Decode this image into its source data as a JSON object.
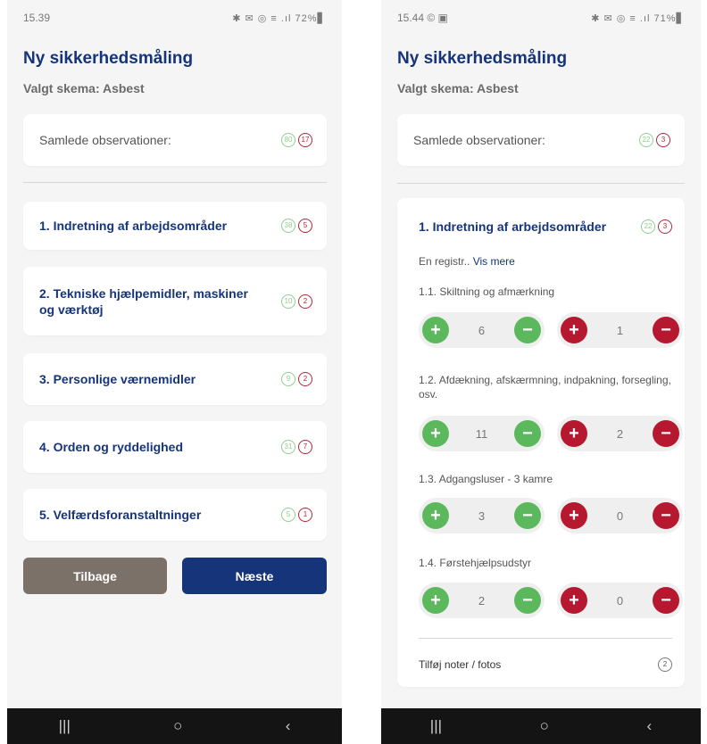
{
  "left": {
    "status_time": "15.39",
    "status_icons": "✱ ✉ ◎ ≡ .ıl 72%▋",
    "title": "Ny sikkerhedsmåling",
    "subtitle": "Valgt skema: Asbest",
    "totals": {
      "label": "Samlede observationer:",
      "green": "80",
      "red": "17"
    },
    "sections": [
      {
        "label": "1. Indretning af arbejdsområder",
        "green": "38",
        "red": "5"
      },
      {
        "label": "2. Tekniske hjælpemidler, maskiner og værktøj",
        "green": "10",
        "red": "2"
      },
      {
        "label": "3. Personlige værnemidler",
        "green": "9",
        "red": "2"
      },
      {
        "label": "4. Orden og ryddelighed",
        "green": "31",
        "red": "7"
      },
      {
        "label": "5. Velfærdsforanstaltninger",
        "green": "5",
        "red": "1"
      }
    ],
    "back_label": "Tilbage",
    "next_label": "Næste"
  },
  "right": {
    "status_time": "15.44 © ▣",
    "status_icons": "✱ ✉ ◎ ≡ .ıl 71%▋",
    "title": "Ny sikkerhedsmåling",
    "subtitle": "Valgt skema: Asbest",
    "totals": {
      "label": "Samlede observationer:",
      "green": "22",
      "red": "3"
    },
    "section": {
      "label": "1. Indretning af arbejdsområder",
      "green": "22",
      "red": "3",
      "meta": "En registr..",
      "more_link": "Vis mere",
      "items": [
        {
          "label": "1.1. Skiltning og afmærkning",
          "positive": "6",
          "negative": "1"
        },
        {
          "label": "1.2. Afdækning, afskærmning, indpakning, forsegling, osv.",
          "positive": "11",
          "negative": "2"
        },
        {
          "label": "1.3. Adgangsluser - 3 kamre",
          "positive": "3",
          "negative": "0"
        },
        {
          "label": "1.4. Førstehjælpsudstyr",
          "positive": "2",
          "negative": "0"
        }
      ],
      "notes_label": "Tilføj noter / fotos",
      "notes_count": "2"
    }
  },
  "navbar": {
    "recents": "|||",
    "home": "○",
    "back": "‹"
  },
  "colors": {
    "primary": "#16347a",
    "back_button": "#7b7168",
    "green": "#5cb85c",
    "red": "#b5182f"
  }
}
